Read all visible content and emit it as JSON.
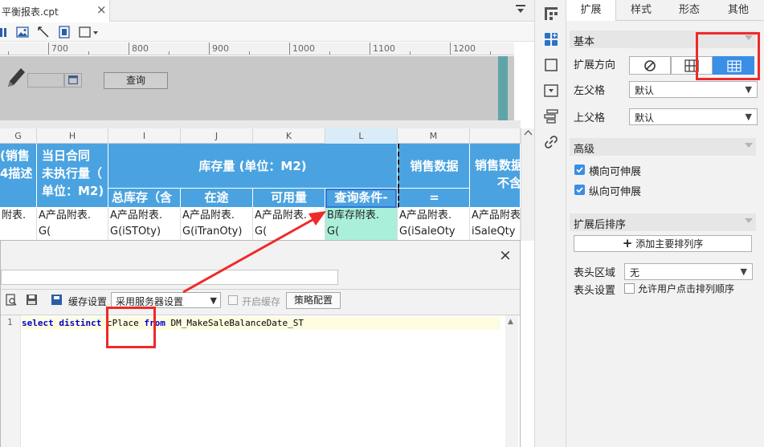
{
  "tab": {
    "title": "平衡报表.cpt",
    "close": "×"
  },
  "ruler": {
    "labels": [
      "700",
      "800",
      "900",
      "1000",
      "1100",
      "1200"
    ]
  },
  "form": {
    "query_button": "查询"
  },
  "columns": [
    {
      "letter": "G"
    },
    {
      "letter": "H"
    },
    {
      "letter": "I"
    },
    {
      "letter": "J"
    },
    {
      "letter": "K"
    },
    {
      "letter": "L"
    },
    {
      "letter": "M"
    },
    {
      "letter": ""
    }
  ],
  "sheet": {
    "header_row1": {
      "g": [
        "(销售",
        "4描述"
      ],
      "h": [
        "当日合同",
        "未执行量（",
        "单位：M2)"
      ],
      "inventory": "库存量 (单位：M2)",
      "sales": "销售数据",
      "sales_excl": [
        "销售数据",
        "不含"
      ]
    },
    "header_row2": {
      "i": "总库存（含",
      "j": "在途",
      "k": "可用量",
      "l": "查询条件-",
      "m": "="
    },
    "data_row": {
      "g": "附表.",
      "h": [
        "A产品附表.",
        "G("
      ],
      "i": [
        "A产品附表.",
        "G(iSTOty)"
      ],
      "j": [
        "A产品附表.",
        "G(iTranOty)"
      ],
      "k": [
        "A产品附表.",
        "G("
      ],
      "l": [
        "B库存附表.",
        "G("
      ],
      "m": [
        "A产品附表.",
        "G(iSaleOty"
      ],
      "n": [
        "A产品附表",
        "iSaleQty"
      ]
    }
  },
  "dialog": {
    "close": "×",
    "cache_label": "缓存设置",
    "cache_select_value": "采用服务器设置",
    "enable_cache": "开启缓存",
    "strategy_button": "策略配置",
    "line_number": "1",
    "sql": {
      "kw1": "select distinct",
      "field": "cPlace",
      "kw2": "from",
      "table": "DM_MakeSaleBalanceDate_ST"
    }
  },
  "panel": {
    "tabs": [
      "扩展",
      "样式",
      "形态",
      "其他"
    ],
    "active_tab": "扩展",
    "section_basic": "基本",
    "expand_direction_label": "扩展方向",
    "left_parent_label": "左父格",
    "left_parent_value": "默认",
    "top_parent_label": "上父格",
    "top_parent_value": "默认",
    "section_advanced": "高级",
    "horizontal_expand": "横向可伸展",
    "vertical_expand": "纵向可伸展",
    "section_sort": "扩展后排序",
    "add_sort_button": "添加主要排列序",
    "add_sort_plus": "+",
    "header_area_label": "表头区域",
    "header_area_value": "无",
    "header_setting_label": "表头设置",
    "allow_sort": "允许用户点击排列顺序"
  },
  "colors": {
    "header_blue": "#4aa3e0",
    "selected_cell": "#a9efd9",
    "selection_border": "#2f76d4",
    "annotation_red": "#ee2a2a",
    "active_segment": "#3a8ee6"
  }
}
